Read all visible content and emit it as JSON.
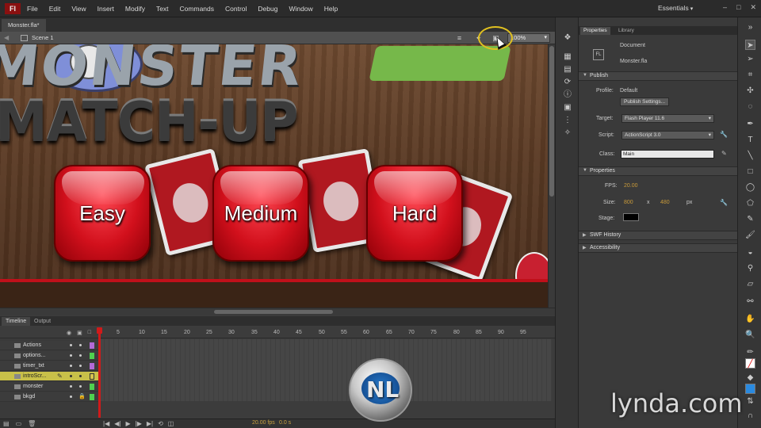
{
  "menubar": {
    "logo": "Fl",
    "items": [
      "File",
      "Edit",
      "View",
      "Insert",
      "Modify",
      "Text",
      "Commands",
      "Control",
      "Debug",
      "Window",
      "Help"
    ],
    "workspace": "Essentials",
    "window_controls": [
      "–",
      "□",
      "✕"
    ]
  },
  "document": {
    "tab": "Monster.fla*",
    "scene": "Scene 1",
    "zoom": "100%"
  },
  "stage": {
    "title_top": "MONSTER",
    "title_bottom": "MATCH-UP",
    "buttons": [
      "Easy",
      "Medium",
      "Hard"
    ]
  },
  "timeline": {
    "tabs": [
      "Timeline",
      "Output"
    ],
    "frame_numbers": [
      "5",
      "10",
      "15",
      "20",
      "25",
      "30",
      "35",
      "40",
      "45",
      "50",
      "55",
      "60",
      "65",
      "70",
      "75",
      "80",
      "85",
      "90",
      "95"
    ],
    "layers": [
      {
        "name": "Actions",
        "color": "#b36ad6",
        "selected": false
      },
      {
        "name": "options...",
        "color": "#4fd04f",
        "selected": false
      },
      {
        "name": "timer_txt",
        "color": "#b36ad6",
        "selected": false
      },
      {
        "name": "introScr...",
        "color": "#d6c34f",
        "selected": true
      },
      {
        "name": "monster",
        "color": "#4fd04f",
        "selected": false
      },
      {
        "name": "bkgd",
        "color": "#4fd04f",
        "selected": false
      }
    ],
    "footer_fps": "20.00 fps",
    "footer_time": "0.0 s"
  },
  "panel": {
    "tabs": [
      "Properties",
      "Library"
    ],
    "doc_type": "Document",
    "doc_icon": "FL",
    "doc_name": "Monster.fla",
    "publish": {
      "header": "Publish",
      "profile_label": "Profile:",
      "profile_value": "Default",
      "settings_button": "Publish Settings...",
      "target_label": "Target:",
      "target_value": "Flash Player 11.6",
      "script_label": "Script:",
      "script_value": "ActionScript 3.0",
      "class_label": "Class:",
      "class_value": "Main"
    },
    "properties": {
      "header": "Properties",
      "fps_label": "FPS:",
      "fps_value": "20.00",
      "size_label": "Size:",
      "width": "800",
      "x": "x",
      "height": "480",
      "unit": "px",
      "stage_label": "Stage:",
      "stage_color": "#000000"
    },
    "swf_history": "SWF History",
    "accessibility": "Accessibility"
  },
  "watermark": {
    "logo_text": "NL",
    "brand": "lynda.com"
  },
  "colors": {
    "accent_red": "#d2101c",
    "selected_layer": "#c8c049",
    "playhead": "#d01a1a",
    "highlight_ring": "#e0c020"
  }
}
